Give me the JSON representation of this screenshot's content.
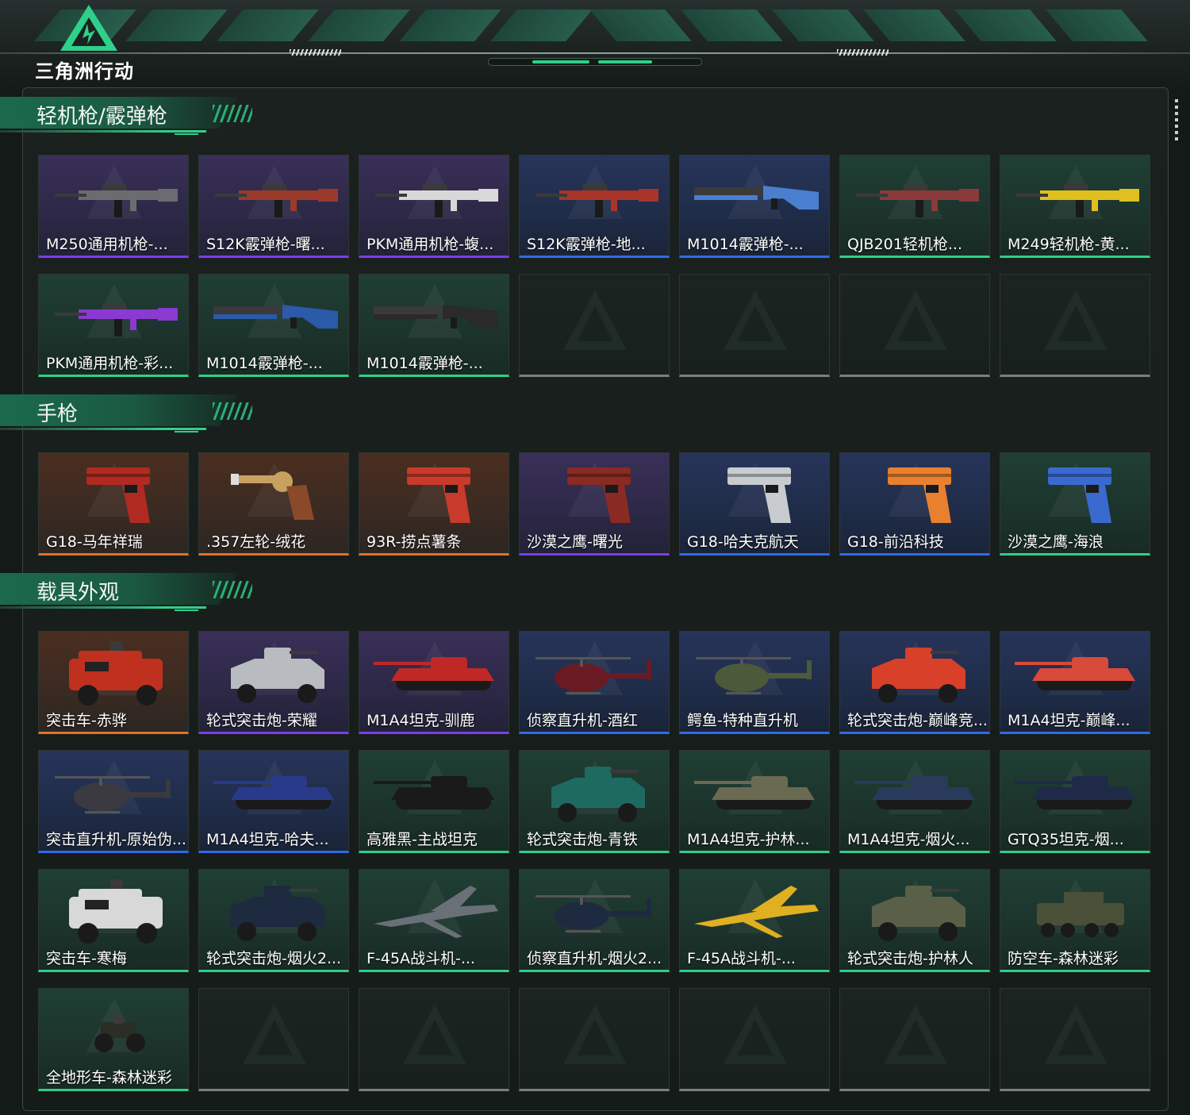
{
  "header": {
    "logo_text": "三角洲行动"
  },
  "sections": [
    {
      "title": "轻机枪/霰弹枪",
      "items": [
        {
          "label": "M250通用机枪-...",
          "rarity": "purple",
          "kind": "gun",
          "color": "#6a6c70"
        },
        {
          "label": "S12K霰弹枪-曙...",
          "rarity": "purple",
          "kind": "gun",
          "color": "#9a3a2a"
        },
        {
          "label": "PKM通用机枪-蝮...",
          "rarity": "purple",
          "kind": "gun",
          "color": "#d8d8d8"
        },
        {
          "label": "S12K霰弹枪-地...",
          "rarity": "blue",
          "kind": "gun",
          "color": "#a8342a"
        },
        {
          "label": "M1014霰弹枪-...",
          "rarity": "blue",
          "kind": "shotgun",
          "color": "#4a7fd0"
        },
        {
          "label": "QJB201轻机枪...",
          "rarity": "green",
          "kind": "gun",
          "color": "#8a3a3a"
        },
        {
          "label": "M249轻机枪-黄...",
          "rarity": "green",
          "kind": "gun",
          "color": "#e0c020"
        },
        {
          "label": "PKM通用机枪-彩...",
          "rarity": "green",
          "kind": "gun",
          "color": "#8a3ad0"
        },
        {
          "label": "M1014霰弹枪-...",
          "rarity": "green",
          "kind": "shotgun",
          "color": "#2a5aa8"
        },
        {
          "label": "M1014霰弹枪-...",
          "rarity": "green",
          "kind": "shotgun",
          "color": "#2a2a2a"
        },
        {
          "empty": true
        },
        {
          "empty": true
        },
        {
          "empty": true
        },
        {
          "empty": true
        }
      ]
    },
    {
      "title": "手枪",
      "items": [
        {
          "label": "G18-马年祥瑞",
          "rarity": "orange",
          "kind": "pistol",
          "color": "#b02a22"
        },
        {
          "label": ".357左轮-绒花",
          "rarity": "orange",
          "kind": "revolver",
          "color": "#c8a060"
        },
        {
          "label": "93R-捞点薯条",
          "rarity": "orange",
          "kind": "pistol",
          "color": "#c83a2a"
        },
        {
          "label": "沙漠之鹰-曙光",
          "rarity": "purple",
          "kind": "pistol",
          "color": "#8a2a22"
        },
        {
          "label": "G18-哈夫克航天",
          "rarity": "blue",
          "kind": "pistol",
          "color": "#c8ccd0"
        },
        {
          "label": "G18-前沿科技",
          "rarity": "blue",
          "kind": "pistol",
          "color": "#e88030"
        },
        {
          "label": "沙漠之鹰-海浪",
          "rarity": "green",
          "kind": "pistol",
          "color": "#3a6ad0"
        }
      ]
    },
    {
      "title": "载具外观",
      "items": [
        {
          "label": "突击车-赤骅",
          "rarity": "orange",
          "kind": "truck",
          "color": "#c0301e"
        },
        {
          "label": "轮式突击炮-荣耀",
          "rarity": "purple",
          "kind": "armored",
          "color": "#b8bcc0"
        },
        {
          "label": "M1A4坦克-驯鹿",
          "rarity": "purple",
          "kind": "tank",
          "color": "#c02828"
        },
        {
          "label": "侦察直升机-酒红",
          "rarity": "blue",
          "kind": "heli",
          "color": "#6a1a22"
        },
        {
          "label": "鳄鱼-特种直升机",
          "rarity": "blue",
          "kind": "heli",
          "color": "#4a5a3a"
        },
        {
          "label": "轮式突击炮-巅峰竞...",
          "rarity": "blue",
          "kind": "armored",
          "color": "#d8402a"
        },
        {
          "label": "M1A4坦克-巅峰...",
          "rarity": "blue",
          "kind": "tank",
          "color": "#d84a3a"
        },
        {
          "label": "突击直升机-原始伪...",
          "rarity": "blue",
          "kind": "heli",
          "color": "#3a3a40"
        },
        {
          "label": "M1A4坦克-哈夫...",
          "rarity": "blue",
          "kind": "tank",
          "color": "#2a3a8a"
        },
        {
          "label": "高雅黑-主战坦克",
          "rarity": "green",
          "kind": "tank",
          "color": "#1a1a1a"
        },
        {
          "label": "轮式突击炮-青铁",
          "rarity": "green",
          "kind": "armored",
          "color": "#1e6a60"
        },
        {
          "label": "M1A4坦克-护林...",
          "rarity": "green",
          "kind": "tank",
          "color": "#6a6a52"
        },
        {
          "label": "M1A4坦克-烟火...",
          "rarity": "green",
          "kind": "tank",
          "color": "#2a3a5a"
        },
        {
          "label": "GTQ35坦克-烟...",
          "rarity": "green",
          "kind": "tank",
          "color": "#1e2a48"
        },
        {
          "label": "突击车-寒梅",
          "rarity": "green",
          "kind": "truck",
          "color": "#d8d8d8"
        },
        {
          "label": "轮式突击炮-烟火2...",
          "rarity": "green",
          "kind": "armored",
          "color": "#1e2a40"
        },
        {
          "label": "F-45A战斗机-...",
          "rarity": "green",
          "kind": "jet",
          "color": "#6a7078"
        },
        {
          "label": "侦察直升机-烟火2...",
          "rarity": "green",
          "kind": "heli",
          "color": "#1e2a40"
        },
        {
          "label": "F-45A战斗机-...",
          "rarity": "green",
          "kind": "jet",
          "color": "#e0b020"
        },
        {
          "label": "轮式突击炮-护林人",
          "rarity": "green",
          "kind": "armored",
          "color": "#5a6048"
        },
        {
          "label": "防空车-森林迷彩",
          "rarity": "green",
          "kind": "apc",
          "color": "#4a5038"
        },
        {
          "label": "全地形车-森林迷彩",
          "rarity": "green",
          "kind": "atv",
          "color": "#2a2e24"
        },
        {
          "empty": true
        },
        {
          "empty": true
        },
        {
          "empty": true
        },
        {
          "empty": true
        },
        {
          "empty": true
        },
        {
          "empty": true
        }
      ]
    }
  ]
}
